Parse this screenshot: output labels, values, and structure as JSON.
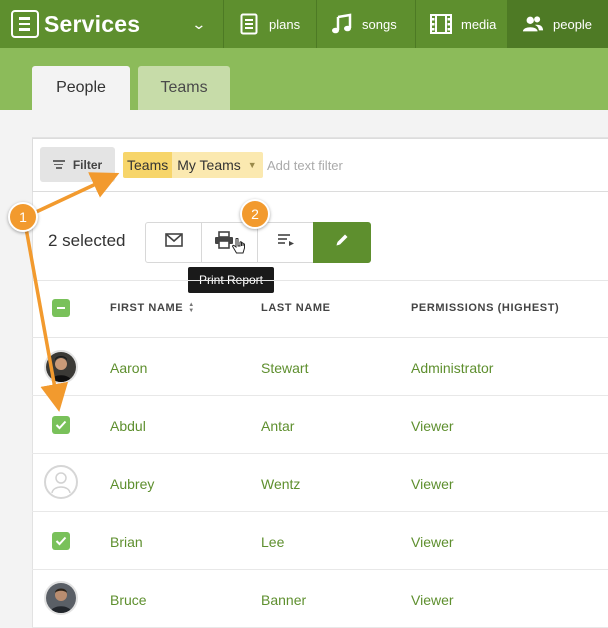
{
  "app": {
    "title": "Services",
    "nav": [
      {
        "label": "plans",
        "icon": "plans-icon"
      },
      {
        "label": "songs",
        "icon": "music-note-icon"
      },
      {
        "label": "media",
        "icon": "film-icon"
      },
      {
        "label": "people",
        "icon": "people-icon",
        "active": true
      }
    ]
  },
  "tabs": [
    {
      "label": "People",
      "active": true
    },
    {
      "label": "Teams",
      "active": false
    }
  ],
  "filter": {
    "button_label": "Filter",
    "chip_key": "Teams",
    "chip_value": "My Teams",
    "text_placeholder": "Add text filter"
  },
  "selection": {
    "count_label": "2 selected"
  },
  "actions": [
    {
      "name": "email",
      "icon": "envelope-icon"
    },
    {
      "name": "print-report",
      "icon": "printer-icon"
    },
    {
      "name": "sort",
      "icon": "list-sort-icon"
    },
    {
      "name": "edit",
      "icon": "pencil-icon"
    }
  ],
  "tooltip": "Print Report",
  "table": {
    "columns": [
      "FIRST NAME",
      "LAST NAME",
      "PERMISSIONS (HIGHEST)"
    ],
    "rows": [
      {
        "first": "Aaron",
        "last": "Stewart",
        "permission": "Administrator",
        "marker": "avatar"
      },
      {
        "first": "Abdul",
        "last": "Antar",
        "permission": "Viewer",
        "marker": "checked"
      },
      {
        "first": "Aubrey",
        "last": "Wentz",
        "permission": "Viewer",
        "marker": "avatar-placeholder"
      },
      {
        "first": "Brian",
        "last": "Lee",
        "permission": "Viewer",
        "marker": "checked"
      },
      {
        "first": "Bruce",
        "last": "Banner",
        "permission": "Viewer",
        "marker": "avatar"
      }
    ]
  },
  "annotations": [
    {
      "label": "1"
    },
    {
      "label": "2"
    }
  ],
  "colors": {
    "brand_green": "#5e8f2e",
    "strip_green": "#8cbb5a",
    "check_green": "#79c15a",
    "chip_yellow": "#f7d56a",
    "annotation_orange": "#f29a2e"
  }
}
